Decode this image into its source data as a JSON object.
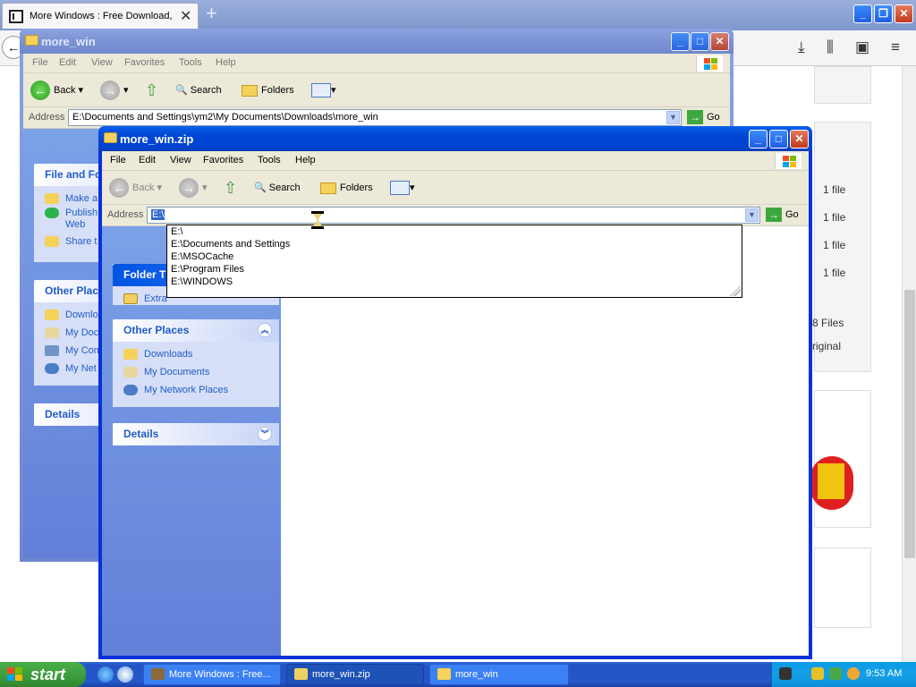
{
  "firefox": {
    "tab_title": "More Windows : Free Download, E",
    "new_tab": "+",
    "close_tab": "✕",
    "file_counts": [
      "1 file",
      "1 file",
      "1 file",
      "1 file"
    ],
    "files_text": "8 Files",
    "original_text": "riginal"
  },
  "win_back": {
    "title": "more_win",
    "menu": [
      "File",
      "Edit",
      "View",
      "Favorites",
      "Tools",
      "Help"
    ],
    "toolbar": {
      "back": "Back",
      "search": "Search",
      "folders": "Folders"
    },
    "address_label": "Address",
    "address_value": "E:\\Documents and Settings\\ym2\\My Documents\\Downloads\\more_win",
    "go": "Go",
    "file_tasks_header": "File and Fo",
    "file_tasks": [
      "Make a",
      "Publish\nWeb",
      "Share t"
    ],
    "other_places_header": "Other Plac",
    "other_places": [
      "Downlo",
      "My Doc",
      "My Com",
      "My Net"
    ],
    "details_header": "Details"
  },
  "win_front": {
    "title": "more_win.zip",
    "menu": [
      "File",
      "Edit",
      "View",
      "Favorites",
      "Tools",
      "Help"
    ],
    "toolbar": {
      "back": "Back",
      "search": "Search",
      "folders": "Folders"
    },
    "address_label": "Address",
    "address_value": "E:\\",
    "go": "Go",
    "folder_tasks_header": "Folder T",
    "folder_tasks": [
      "Extra"
    ],
    "other_places_header": "Other Places",
    "other_places": [
      "Downloads",
      "My Documents",
      "My Network Places"
    ],
    "details_header": "Details"
  },
  "address_dropdown": [
    "E:\\",
    "E:\\Documents and Settings",
    "E:\\MSOCache",
    "E:\\Program Files",
    "E:\\WINDOWS"
  ],
  "taskbar": {
    "start": "start",
    "buttons": [
      "More Windows : Free...",
      "more_win.zip",
      "more_win"
    ],
    "clock": "9:53 AM"
  },
  "colors": {
    "xp_blue": "#0054e3",
    "start_green": "#3c9b3c",
    "taskbar": "#2454c4"
  }
}
